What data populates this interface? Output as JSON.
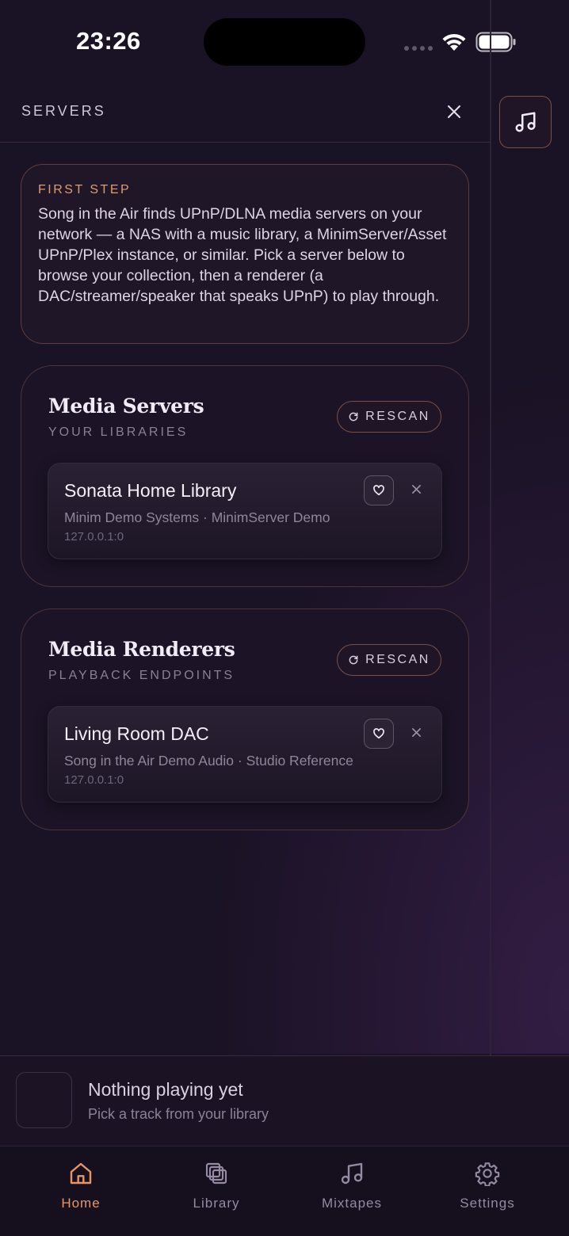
{
  "status_bar": {
    "time": "23:26"
  },
  "header": {
    "title": "SERVERS"
  },
  "first_step": {
    "label": "FIRST STEP",
    "text": "Song in the Air finds UPnP/DLNA media servers on your network — a NAS with a music library, a MinimServer/Asset UPnP/Plex instance, or similar. Pick a server below to browse your collection, then a renderer (a DAC/streamer/speaker that speaks UPnP) to play through."
  },
  "media_servers": {
    "title": "Media Servers",
    "subtitle": "YOUR LIBRARIES",
    "rescan_label": "RESCAN",
    "devices": [
      {
        "name": "Sonata Home Library",
        "meta": "Minim Demo Systems · MinimServer Demo",
        "address": "127.0.0.1:0"
      }
    ]
  },
  "media_renderers": {
    "title": "Media Renderers",
    "subtitle": "PLAYBACK ENDPOINTS",
    "rescan_label": "RESCAN",
    "devices": [
      {
        "name": "Living Room DAC",
        "meta": "Song in the Air Demo Audio · Studio Reference",
        "address": "127.0.0.1:0"
      }
    ]
  },
  "now_playing": {
    "title": "Nothing playing yet",
    "subtitle": "Pick a track from your library"
  },
  "tabs": [
    {
      "label": "Home",
      "icon": "home-icon",
      "active": true
    },
    {
      "label": "Library",
      "icon": "library-icon",
      "active": false
    },
    {
      "label": "Mixtapes",
      "icon": "music-note-icon",
      "active": false
    },
    {
      "label": "Settings",
      "icon": "gear-icon",
      "active": false
    }
  ],
  "colors": {
    "background": "#1a1225",
    "accent": "#e89566",
    "border_accent": "#7c4f44",
    "text_primary": "#f4eff7",
    "text_muted": "#8f8699"
  }
}
